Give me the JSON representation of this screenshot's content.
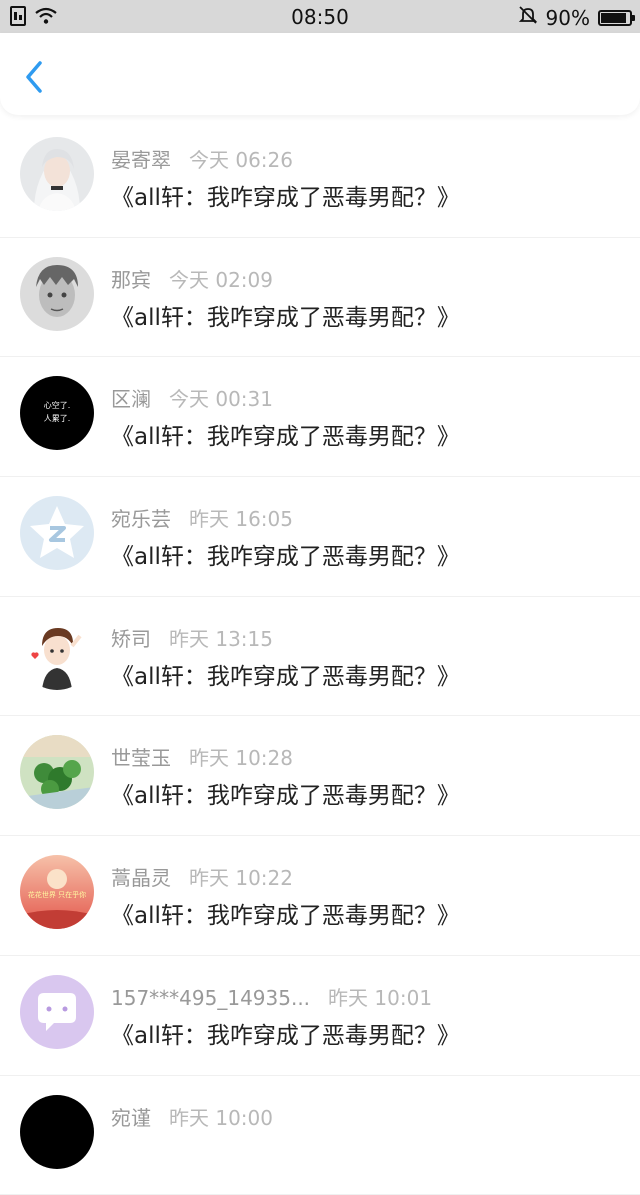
{
  "status_bar": {
    "time": "08:50",
    "battery_text": "90%",
    "battery_level": 0.9
  },
  "icons": {
    "sim": "sim-icon",
    "wifi": "wifi-icon",
    "mute": "bell-off-icon",
    "battery": "battery-icon",
    "back": "chevron-left-icon"
  },
  "colors": {
    "accent": "#2f9bf0",
    "status_bar_bg": "#d8d8d8",
    "meta_text": "#999999"
  },
  "comments": [
    {
      "name": "晏寄翠",
      "time": "今天 06:26",
      "text": "《all轩：我咋穿成了恶毒男配？》"
    },
    {
      "name": "那宾",
      "time": "今天 02:09",
      "text": "《all轩：我咋穿成了恶毒男配？》"
    },
    {
      "name": "区澜",
      "time": "今天 00:31",
      "text": "《all轩：我咋穿成了恶毒男配？》",
      "avatar_text": [
        "心空了.",
        "人累了."
      ]
    },
    {
      "name": "宛乐芸",
      "time": "昨天 16:05",
      "text": "《all轩：我咋穿成了恶毒男配？》"
    },
    {
      "name": "矫司",
      "time": "昨天 13:15",
      "text": "《all轩：我咋穿成了恶毒男配？》"
    },
    {
      "name": "世莹玉",
      "time": "昨天 10:28",
      "text": "《all轩：我咋穿成了恶毒男配？》"
    },
    {
      "name": "蒿晶灵",
      "time": "昨天 10:22",
      "text": "《all轩：我咋穿成了恶毒男配？》",
      "avatar_text": [
        "花花世界 只在乎你"
      ]
    },
    {
      "name": "157***495_14935...",
      "time": "昨天 10:01",
      "text": "《all轩：我咋穿成了恶毒男配？》"
    },
    {
      "name": "宛谨",
      "time": "昨天 10:00",
      "text": ""
    }
  ]
}
